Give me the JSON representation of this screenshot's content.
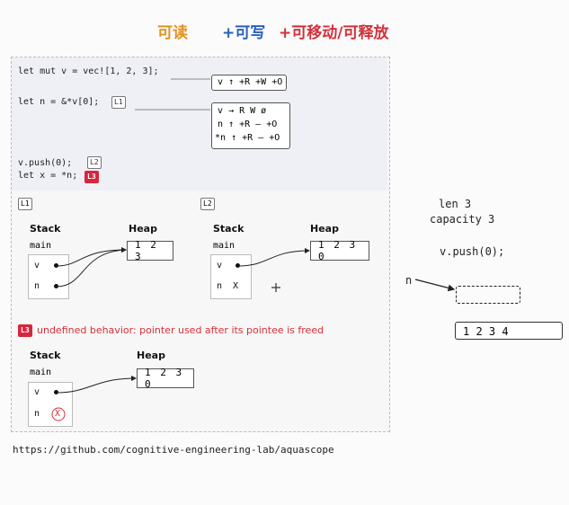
{
  "header": {
    "read": "可读",
    "write": "+可写",
    "move": "+可移动/可释放"
  },
  "code": {
    "line1": "let mut v = vec![1, 2, 3];",
    "line2": "let n = &*v[0];",
    "line3": "v.push(0);",
    "line4": "let x = *n;",
    "tags": [
      "L1",
      "L2",
      "L3"
    ]
  },
  "permissions": {
    "box1": [
      {
        "var": "v",
        "perms": "↑ +R +W +O"
      }
    ],
    "box2": [
      {
        "var": "v",
        "perms": "→ R W ø"
      },
      {
        "var": "n",
        "perms": "↑ +R – +O"
      },
      {
        "var": "*n",
        "perms": "↑ +R – +O"
      }
    ]
  },
  "diagrams": {
    "L1": {
      "label": "L1",
      "stack": "Stack",
      "heap": "Heap",
      "frame": "main",
      "vars": [
        "v",
        "n"
      ],
      "heap_values": "1 2 3"
    },
    "L2": {
      "label": "L2",
      "stack": "Stack",
      "heap": "Heap",
      "frame": "main",
      "vars": [
        "v",
        "n"
      ],
      "n_value": "X",
      "heap_values": "1 2 3 0"
    },
    "L3": {
      "label": "L3",
      "message": "undefined behavior: pointer used after its pointee is freed",
      "stack": "Stack",
      "heap": "Heap",
      "frame": "main",
      "vars": [
        "v",
        "n"
      ],
      "n_value": "X",
      "heap_values": "1 2 3 0"
    }
  },
  "url": "https://github.com/cognitive-engineering-lab/aquascope",
  "right": {
    "len": "len 3",
    "capacity": "capacity 3",
    "push": "v.push(0);",
    "n_label": "n",
    "vec": "1  2  3 4"
  },
  "colors": {
    "read": "#e0931e",
    "write": "#2a5fbf",
    "own": "#d62f3a"
  }
}
